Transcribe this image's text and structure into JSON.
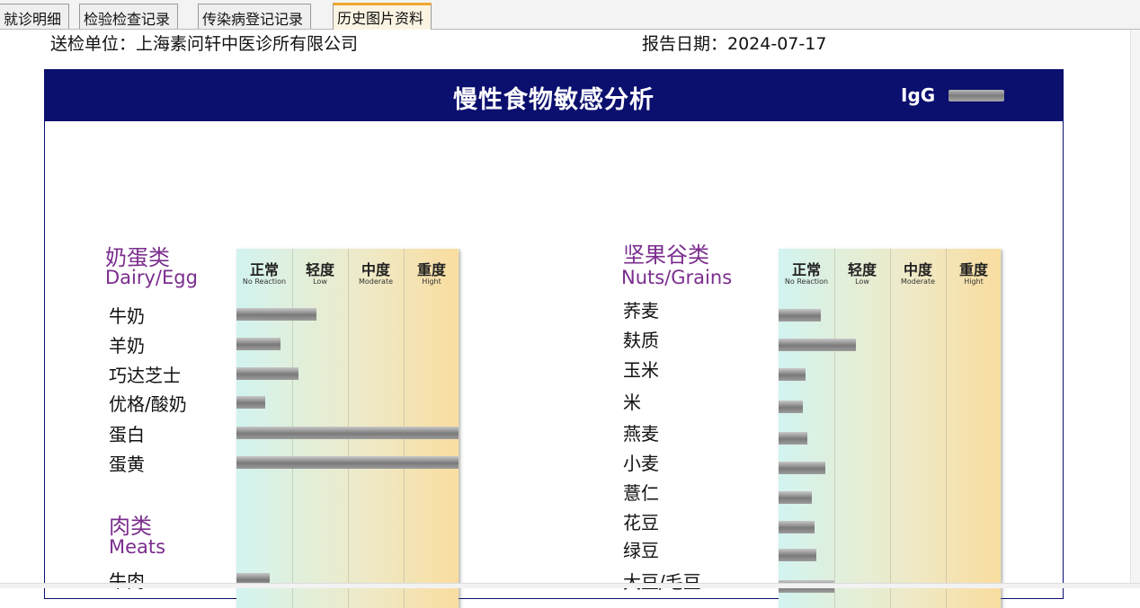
{
  "tabs": [
    {
      "label": "就诊明细"
    },
    {
      "label": "检验检查记录"
    },
    {
      "label": "传染病登记记录"
    },
    {
      "label": "历史图片资料"
    }
  ],
  "header": {
    "sender": "送检单位：上海素问轩中医诊所有限公司",
    "report_date": "报告日期：2024-07-17"
  },
  "report": {
    "title": "慢性食物敏感分析",
    "legend_label": "IgG",
    "columns": [
      {
        "cn": "正常",
        "en": "No Reaction"
      },
      {
        "cn": "轻度",
        "en": "Low"
      },
      {
        "cn": "中度",
        "en": "Moderate"
      },
      {
        "cn": "重度",
        "en": "Hight"
      }
    ],
    "groups": [
      {
        "name_cn": "奶蛋类",
        "name_en": "Dairy/Egg",
        "items": [
          {
            "name": "牛奶",
            "level": 0.36
          },
          {
            "name": "羊奶",
            "level": 0.2
          },
          {
            "name": "巧达芝士",
            "level": 0.28
          },
          {
            "name": "优格/酸奶",
            "level": 0.13
          },
          {
            "name": "蛋白",
            "level": 1.0
          },
          {
            "name": "蛋黄",
            "level": 1.0
          }
        ]
      },
      {
        "name_cn": "肉类",
        "name_en": "Meats",
        "items": [
          {
            "name": "牛肉",
            "level": 0.15
          }
        ]
      },
      {
        "name_cn": "坚果谷类",
        "name_en": "Nuts/Grains",
        "items": [
          {
            "name": "荞麦",
            "level": 0.19
          },
          {
            "name": "麸质",
            "level": 0.35
          },
          {
            "name": "玉米",
            "level": 0.12
          },
          {
            "name": "米",
            "level": 0.11
          },
          {
            "name": "燕麦",
            "level": 0.13
          },
          {
            "name": "小麦",
            "level": 0.21
          },
          {
            "name": "薏仁",
            "level": 0.15
          },
          {
            "name": "花豆",
            "level": 0.16
          },
          {
            "name": "绿豆",
            "level": 0.17
          },
          {
            "name": "大豆/毛豆",
            "level": 0.25
          }
        ]
      }
    ]
  },
  "colors": {
    "banner": "#0b0f6e",
    "category": "#7b2d8e",
    "active_tab_accent": "#f0a830"
  }
}
